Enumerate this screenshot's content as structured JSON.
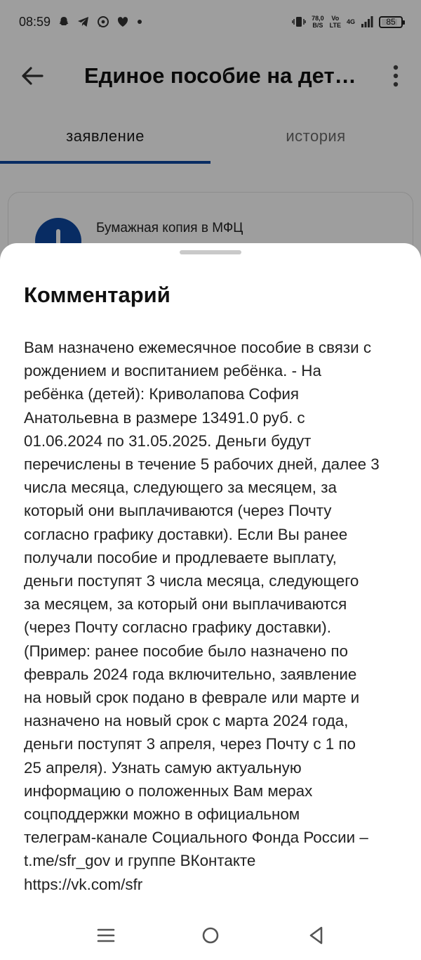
{
  "status_bar": {
    "time": "08:59",
    "left_icons": [
      "snapchat-icon",
      "telegram-icon",
      "whatsapp-icon",
      "heart-icon",
      "dot-icon"
    ],
    "speed_value": "78,0",
    "speed_unit": "B/S",
    "volte_top": "Vo",
    "volte_bottom": "LTE",
    "network": "4G",
    "battery": "85",
    "battery_level": 0.85
  },
  "header": {
    "title": "Единое пособие на дет…"
  },
  "tabs": [
    {
      "label": "заявление",
      "active": true
    },
    {
      "label": "история",
      "active": false
    }
  ],
  "card": {
    "text": "Бумажная копия в МФЦ"
  },
  "sheet": {
    "title": "Комментарий",
    "body": "Вам назначено ежемесячное пособие в связи с\nрождением и воспитанием ребёнка. - На\nребёнка (детей): Криволапова София\nАнатольевна в размере 13491.0 руб. с\n01.06.2024 по 31.05.2025. Деньги будут\nперечислены в течение 5 рабочих дней, далее 3\nчисла месяца, следующего за месяцем, за\nкоторый они выплачиваются (через Почту\nсогласно графику доставки). Если Вы ранее\nполучали пособие и продлеваете выплату,\nденьги поступят 3 числа месяца, следующего\nза месяцем, за который они выплачиваются\n(через Почту согласно графику доставки).\n(Пример: ранее пособие было назначено по\nфевраль 2024 года включительно, заявление\nна новый срок подано в феврале или марте и\nназначено на новый срок с марта 2024 года,\nденьги поступят 3 апреля, через Почту с 1 по\n25 апреля). Узнать самую актуальную\nинформацию о положенных Вам мерах\nсоцподдержки можно в официальном\nтелеграм-канале Социального Фонда России –\nt.me/sfr_gov и группе ВКонтакте\nhttps://vk.com/sfr"
  },
  "nav_bar": {
    "icons": [
      "recents-icon",
      "home-icon",
      "back-icon"
    ]
  },
  "colors": {
    "accent": "#0d47a1",
    "scrim": "rgba(0,0,0,0.38)"
  }
}
